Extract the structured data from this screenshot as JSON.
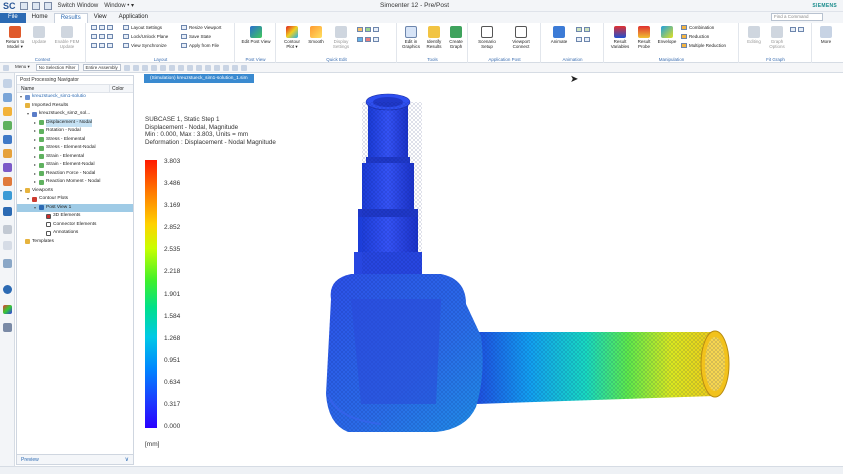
{
  "titlebar": {
    "logo": "SC",
    "switch_window": "Switch Window",
    "window_menu": "Window • ▾",
    "title": "Simcenter 12 - Pre/Post",
    "brand": "SIEMENS",
    "search_placeholder": "Find a Command"
  },
  "menu": {
    "file": "File",
    "tabs": [
      "Home",
      "Results",
      "View",
      "Application"
    ]
  },
  "ribbon": {
    "context": {
      "label": "Context",
      "buttons": [
        "Return to Model ▾",
        "Update",
        "Enable FEM Update"
      ]
    },
    "layout": {
      "label": "Layout",
      "items": [
        "Layout Settings",
        "Lock/Unlock Plane",
        "View Synchronize",
        "Resize Viewport",
        "Save State",
        "Apply from File"
      ]
    },
    "post_view": {
      "label": "Post View",
      "buttons": [
        "Edit Post View"
      ]
    },
    "quick_edit": {
      "label": "Quick Edit",
      "buttons": [
        "Contour Plot ▾",
        "Smooth",
        "Display Settings"
      ]
    },
    "tools": {
      "label": "Tools",
      "buttons": [
        "Edit in Graphics",
        "Identify Results",
        "Create Graph"
      ]
    },
    "app_post": {
      "label": "Application Post",
      "buttons": [
        "Scenario Setup",
        "Viewport Connect"
      ]
    },
    "animation": {
      "label": "Animation",
      "buttons": [
        "Animate"
      ]
    },
    "manipulation": {
      "label": "Manipulation",
      "buttons": [
        "Result Variables",
        "Result Probe",
        "Envelope"
      ],
      "items": [
        "Combination",
        "Reduction",
        "Multiple Reduction"
      ]
    },
    "fit_graph": {
      "label": "Fit Graph",
      "buttons": [
        "Editing",
        "Graph Options"
      ]
    },
    "more": "More"
  },
  "toolbar2": {
    "menu": "Menu ▾",
    "selection_filter": "No Selection Filter",
    "assembly": "Entire Assembly"
  },
  "navigator": {
    "title": "Post Processing Navigator",
    "col_name": "Name",
    "col_color": "Color",
    "rows": [
      {
        "label": "kreuzstueck_sim1-solutio",
        "level": 0,
        "arrow": "▾",
        "kind": "sim"
      },
      {
        "label": "Imported Results",
        "level": 0,
        "arrow": "",
        "kind": "folder"
      },
      {
        "label": "kreuzstueck_sim2_sol...",
        "level": 1,
        "arrow": "▾",
        "kind": "sol"
      },
      {
        "label": "Displacement - Nodal",
        "level": 2,
        "arrow": "▸",
        "kind": "res",
        "selected": true
      },
      {
        "label": "Rotation - Nodal",
        "level": 2,
        "arrow": "▸",
        "kind": "res"
      },
      {
        "label": "Stress - Elemental",
        "level": 2,
        "arrow": "▸",
        "kind": "res"
      },
      {
        "label": "Stress - Element-Nodal",
        "level": 2,
        "arrow": "▸",
        "kind": "res"
      },
      {
        "label": "Strain - Elemental",
        "level": 2,
        "arrow": "▸",
        "kind": "res"
      },
      {
        "label": "Strain - Element-Nodal",
        "level": 2,
        "arrow": "▸",
        "kind": "res"
      },
      {
        "label": "Reaction Force - Nodal",
        "level": 2,
        "arrow": "▸",
        "kind": "res"
      },
      {
        "label": "Reaction Moment - Nodal",
        "level": 2,
        "arrow": "▸",
        "kind": "res"
      },
      {
        "label": "Viewports",
        "level": 0,
        "arrow": "▾",
        "kind": "folder"
      },
      {
        "label": "Contour Plots",
        "level": 1,
        "arrow": "▾",
        "kind": "contour"
      },
      {
        "label": "Post View 1",
        "level": 2,
        "arrow": "▾",
        "kind": "pv",
        "highlight": true
      },
      {
        "label": "3D Elements",
        "level": 3,
        "arrow": "",
        "kind": "check-red"
      },
      {
        "label": "Connector Elements",
        "level": 3,
        "arrow": "",
        "kind": "check"
      },
      {
        "label": "Annotations",
        "level": 3,
        "arrow": "",
        "kind": "check"
      },
      {
        "label": "Templates",
        "level": 0,
        "arrow": "",
        "kind": "folder"
      }
    ],
    "footer": "Preview",
    "footer_arrow": "∨"
  },
  "viewport": {
    "tab": "(Simulation) kreuzstueck_sim1-solution_1.sim",
    "info_lines": [
      "SUBCASE 1, Static Step 1",
      "Displacement - Nodal, Magnitude",
      "Min : 0.000, Max : 3.803, Units = mm",
      "Deformation : Displacement - Nodal Magnitude"
    ],
    "legend_values": [
      "3.803",
      "3.486",
      "3.169",
      "2.852",
      "2.535",
      "2.218",
      "1.901",
      "1.584",
      "1.268",
      "0.951",
      "0.634",
      "0.317",
      "0.000"
    ],
    "units": "[mm]"
  },
  "colors": {
    "accent": "#2c6ab3",
    "selection": "#9fcbe6",
    "tab_active": "#3a8ad0"
  }
}
